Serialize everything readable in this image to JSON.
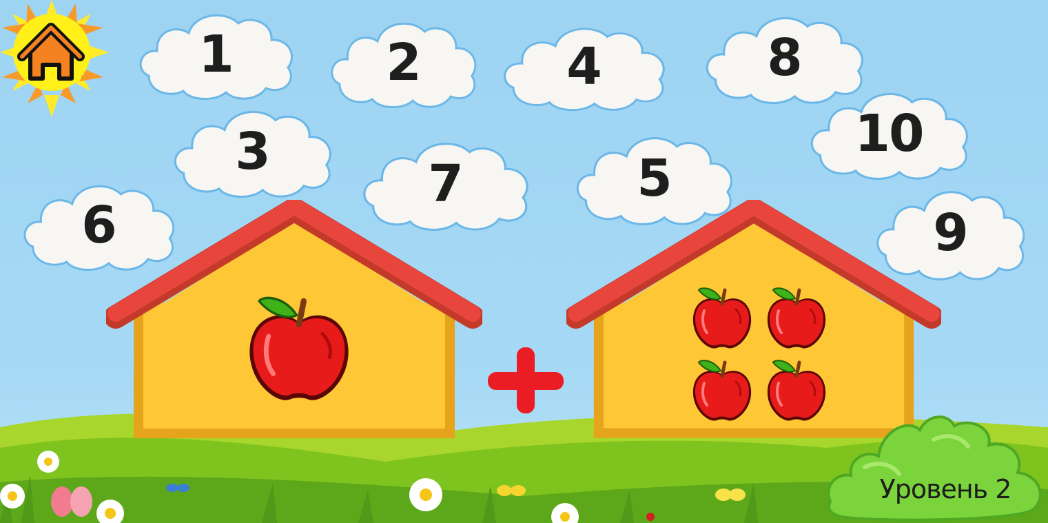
{
  "navigation": {
    "home_icon": "home-icon"
  },
  "answer_clouds": [
    {
      "label": "1"
    },
    {
      "label": "2"
    },
    {
      "label": "4"
    },
    {
      "label": "8"
    },
    {
      "label": "3"
    },
    {
      "label": "7"
    },
    {
      "label": "5"
    },
    {
      "label": "10"
    },
    {
      "label": "6"
    },
    {
      "label": "9"
    }
  ],
  "equation": {
    "left_house_apples": 1,
    "operator_icon": "plus-icon",
    "right_house_apples": 4
  },
  "level": {
    "label": "Уровень 2"
  },
  "colors": {
    "sky": "#a6d9f5",
    "roof": "#e8453c",
    "house_wall": "#fdc735",
    "apple": "#e81b1b",
    "plus": "#ea1c24",
    "sun": "#ffe61a",
    "home_icon": "#f58220",
    "bush": "#7bd43c"
  }
}
